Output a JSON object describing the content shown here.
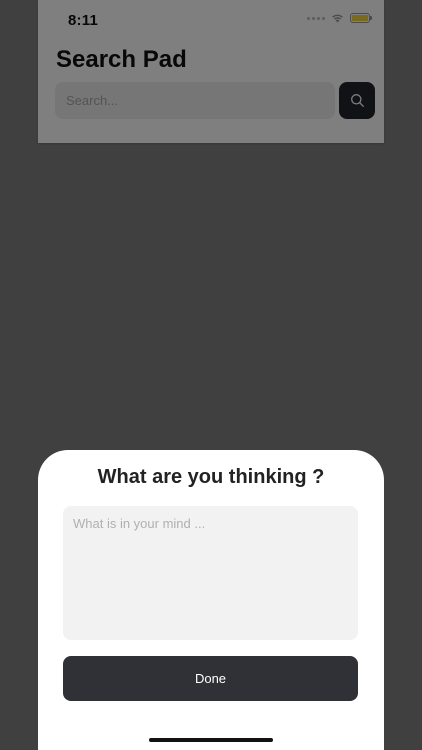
{
  "status_bar": {
    "time": "8:11",
    "battery_color": "#f6d33c"
  },
  "header": {
    "title": "Search Pad"
  },
  "search": {
    "placeholder": "Search...",
    "button_icon": "search-icon"
  },
  "sheet": {
    "title": "What are you thinking ?",
    "input_placeholder": "What is in your mind ...",
    "done_label": "Done"
  },
  "colors": {
    "dark_button": "#2f3137",
    "search_button": "#23252b",
    "overlay": "rgba(0,0,0,0.5)"
  }
}
